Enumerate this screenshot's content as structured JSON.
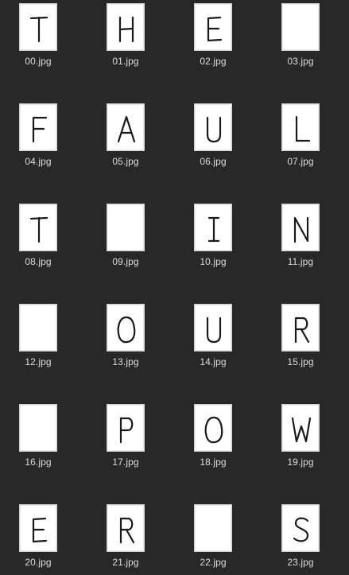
{
  "files": [
    {
      "name": "00.jpg",
      "letter": "T"
    },
    {
      "name": "01.jpg",
      "letter": "H"
    },
    {
      "name": "02.jpg",
      "letter": "E"
    },
    {
      "name": "03.jpg",
      "letter": ""
    },
    {
      "name": "04.jpg",
      "letter": "F"
    },
    {
      "name": "05.jpg",
      "letter": "A"
    },
    {
      "name": "06.jpg",
      "letter": "U"
    },
    {
      "name": "07.jpg",
      "letter": "L"
    },
    {
      "name": "08.jpg",
      "letter": "T"
    },
    {
      "name": "09.jpg",
      "letter": ""
    },
    {
      "name": "10.jpg",
      "letter": "I"
    },
    {
      "name": "11.jpg",
      "letter": "N"
    },
    {
      "name": "12.jpg",
      "letter": ""
    },
    {
      "name": "13.jpg",
      "letter": "O"
    },
    {
      "name": "14.jpg",
      "letter": "U"
    },
    {
      "name": "15.jpg",
      "letter": "R"
    },
    {
      "name": "16.jpg",
      "letter": ""
    },
    {
      "name": "17.jpg",
      "letter": "P"
    },
    {
      "name": "18.jpg",
      "letter": "O"
    },
    {
      "name": "19.jpg",
      "letter": "W"
    },
    {
      "name": "20.jpg",
      "letter": "E"
    },
    {
      "name": "21.jpg",
      "letter": "R"
    },
    {
      "name": "22.jpg",
      "letter": ""
    },
    {
      "name": "23.jpg",
      "letter": "S"
    }
  ],
  "colors": {
    "background": "#282828",
    "label": "#dcdcdc",
    "thumbnail": "#ffffff",
    "ink": "#1a1a1a"
  }
}
